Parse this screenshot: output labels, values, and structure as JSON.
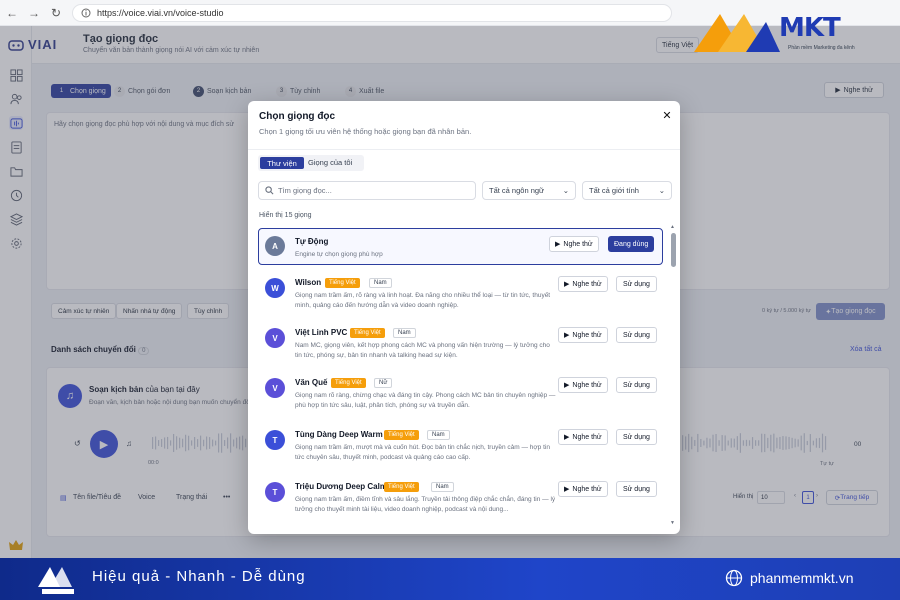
{
  "browser": {
    "url": "https://voice.viai.vn/voice-studio"
  },
  "app": {
    "logo": "VIAI",
    "title": "Tạo giọng đọc",
    "subtitle": "Chuyển văn bản thành giọng nói AI với cảm xúc tự nhiên",
    "language": "Tiếng Việt"
  },
  "steps": [
    {
      "num": "1",
      "label": "Chọn giọng"
    },
    {
      "num": "2",
      "label": "Chọn gói đơn"
    },
    {
      "num": "2",
      "label": "Soạn kịch bản"
    },
    {
      "num": "3",
      "label": "Tùy chỉnh"
    },
    {
      "num": "4",
      "label": "Xuất file"
    }
  ],
  "toolbar": {
    "listen_label": "Nghe thử"
  },
  "editor": {
    "placeholder": "Hãy chọn giọng đọc phù hợp với nội dung và mục đích sử",
    "chips": [
      "Cảm xúc tự nhiên",
      "Nhấn nhá tự động",
      "Tùy chỉnh"
    ],
    "char_count": "0 ký tự / 5.000 ký tự",
    "create_label": "Tạo giọng đọc"
  },
  "list": {
    "title": "Danh sách chuyển đổi",
    "count": "0",
    "clear_all": "Xóa tất cả",
    "script_title_bold": "Soạn kịch bản",
    "script_title_rest": " của bạn tại đây",
    "script_sub": "Đoạn văn, kịch bản hoặc nội dung bạn muốn chuyển đổi",
    "time_start": "00:0",
    "speed": "00",
    "time_end": "Tự tự",
    "columns": [
      "Tên file/Tiêu đề",
      "Voice",
      "Trạng thái",
      "•••"
    ],
    "showing": "Hiển thị",
    "per_page": "10",
    "page": "1",
    "next_label": "Trang tiếp"
  },
  "modal": {
    "title": "Chọn giọng đọc",
    "subtitle": "Chọn 1 giọng tối ưu viên hệ thống hoặc giọng bạn đã nhân bản.",
    "tabs": [
      "Thư viện",
      "Giọng của tôi"
    ],
    "search_placeholder": "Tìm giọng đọc...",
    "filter_language": "Tất cả ngôn ngữ",
    "filter_gender": "Tất cả giới tính",
    "count_text": "Hiển thị 15 giọng",
    "listen_label": "Nghe thử",
    "use_label": "Sử dụng",
    "using_label": "Đang dùng",
    "voices": [
      {
        "initial": "A",
        "name": "Tự Động",
        "desc": "Engine tự chọn giọng phù hợp",
        "lang": "",
        "gender": "",
        "color": "#6b7a99"
      },
      {
        "initial": "W",
        "name": "Wilson",
        "lang": "Tiếng Việt",
        "gender": "Nam",
        "desc": "Giọng nam trầm ấm, rõ ràng và linh hoạt. Đa năng cho nhiều thể loại — từ tin tức, thuyết minh, quảng cáo đến hướng dẫn và video doanh nghiệp.",
        "color": "#3b4fd8"
      },
      {
        "initial": "V",
        "name": "Việt Linh PVC",
        "lang": "Tiếng Việt",
        "gender": "Nam",
        "desc": "Nam MC, giọng viên, kết hợp phong cách MC và phong vấn hiện trường — lý tưởng cho tin tức, phóng sự, bản tin nhanh và talking head sự kiện.",
        "color": "#5b4fd8"
      },
      {
        "initial": "V",
        "name": "Văn Quế",
        "lang": "Tiếng Việt",
        "gender": "Nữ",
        "desc": "Giọng nam rõ ràng, chừng chạc và đáng tin cậy. Phong cách MC bản tin chuyên nghiệp — phù hợp tin tức sâu, luật, phân tích, phóng sự và truyền dẫn.",
        "color": "#5b4fd8"
      },
      {
        "initial": "T",
        "name": "Tùng Dàng Deep Warm",
        "lang": "Tiếng Việt",
        "gender": "Nam",
        "desc": "Giọng nam trầm ấm, mượt mà và cuốn hút. Đọc bản tin chắc nịch, truyền cảm — hợp tin tức chuyên sâu, thuyết minh, podcast và quảng cáo cao cấp.",
        "color": "#3b4fd8"
      },
      {
        "initial": "T",
        "name": "Triệu Dương Deep Calm",
        "lang": "Tiếng Việt",
        "gender": "Nam",
        "desc": "Giọng nam trầm ấm, điềm tĩnh và sâu lắng. Truyền tải thông điệp chắc chắn, đáng tin — lý tưởng cho thuyết minh tài liệu, video doanh nghiệp, podcast và nội dung...",
        "color": "#5b4fd8"
      }
    ]
  },
  "watermark": {
    "brand": "MKT",
    "tagline": "Phần mềm Marketing đa kênh"
  },
  "footer": {
    "slogan": "Hiệu quả - Nhanh - Dễ dùng",
    "site": "phanmemmkt.vn"
  },
  "colors": {
    "primary": "#2c3e9e",
    "accent": "#3b4fd8",
    "tag": "#f59e0b"
  }
}
